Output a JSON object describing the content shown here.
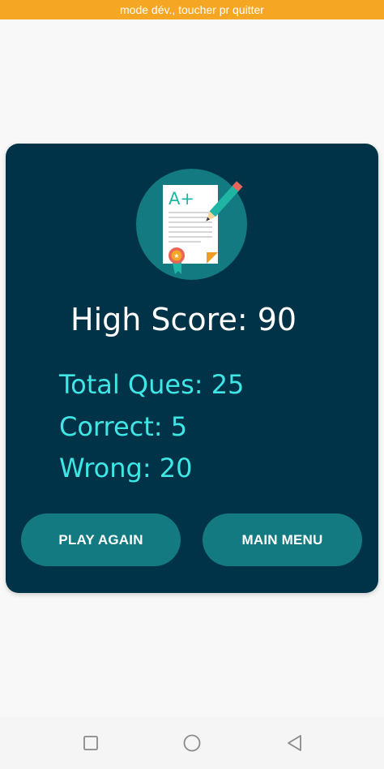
{
  "system": {
    "dev_banner": "mode dév., toucher pr quitter"
  },
  "result": {
    "high_score_label": "High Score: 90",
    "total_label": "Total Ques: 25",
    "correct_label": "Correct: 5",
    "wrong_label": "Wrong: 20",
    "badge_icon": "graded-paper-icon",
    "badge_text": "A+"
  },
  "buttons": {
    "play_again": "PLAY AGAIN",
    "main_menu": "MAIN MENU"
  },
  "navbar": {
    "recent_icon": "square-icon",
    "home_icon": "circle-icon",
    "back_icon": "triangle-back-icon"
  },
  "colors": {
    "card_bg": "#003347",
    "accent": "#3ee6e6",
    "button_bg": "#137a82",
    "banner": "#f5a623"
  }
}
